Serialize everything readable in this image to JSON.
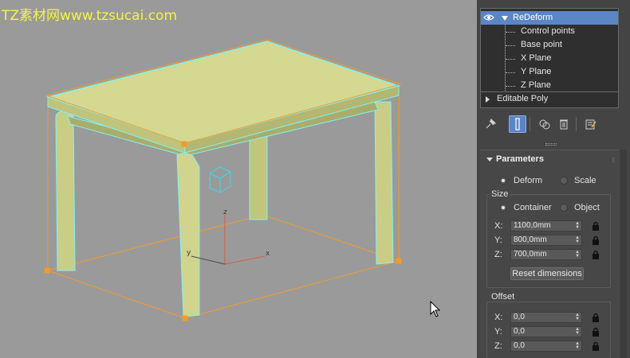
{
  "watermark": "TZ素材网www.tzsucai.com",
  "viewport": {
    "axis_labels": {
      "z": "z",
      "y": "y",
      "x": "x"
    },
    "colors": {
      "background": "#9a9a9a",
      "mesh_fill": "#c9cd86",
      "selection_outline": "#7ff3f3",
      "gizmo_box": "#f39a2a",
      "axis_tripod": "#d06040"
    }
  },
  "modifier_stack": {
    "items": [
      {
        "label": "ReDeform",
        "selected": true,
        "expanded": true
      },
      {
        "label": "Control points"
      },
      {
        "label": "Base point"
      },
      {
        "label": "X Plane"
      },
      {
        "label": "Y Plane"
      },
      {
        "label": "Z Plane"
      },
      {
        "label": "Editable Poly",
        "expanded": false
      }
    ]
  },
  "toolbar": {
    "icons": [
      "pin-stack-icon",
      "show-end-result-icon",
      "make-unique-icon",
      "remove-modifier-icon",
      "configure-modifier-sets-icon"
    ]
  },
  "parameters": {
    "title": "Parameters",
    "mode": {
      "options": [
        "Deform",
        "Scale"
      ],
      "selected": "Deform"
    },
    "size": {
      "title": "Size",
      "options": [
        "Container",
        "Object"
      ],
      "selected": "Container",
      "x_label": "X:",
      "x_value": "1100,0mm",
      "y_label": "Y:",
      "y_value": "800,0mm",
      "z_label": "Z:",
      "z_value": "700,0mm",
      "reset_label": "Reset dimensions"
    },
    "offset": {
      "title": "Offset",
      "x_label": "X:",
      "x_value": "0,0",
      "y_label": "Y:",
      "y_value": "0,0",
      "z_label": "Z:",
      "z_value": "0,0"
    }
  }
}
